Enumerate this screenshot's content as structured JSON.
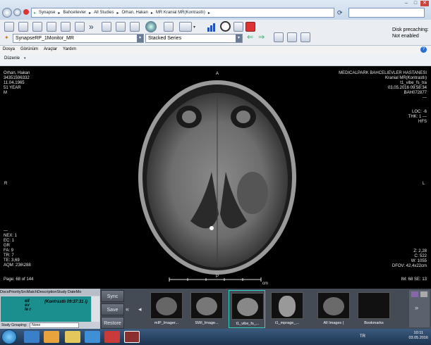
{
  "browser": {
    "breadcrumb": [
      "Synapse",
      "Bahcelievler",
      "All Studies",
      "Orhan, Hakan",
      "MR Kranial MR(Kontrastlı)"
    ]
  },
  "toolbar": {
    "layout_dropdown": "SynapseRP_1Monitor_MR",
    "series_dropdown": "Stacked Series",
    "disk_status_line1": "Disk precaching:",
    "disk_status_line2": "Not enabled"
  },
  "menu": [
    "Dosya",
    "Görünüm",
    "Araçlar",
    "Yardım"
  ],
  "subbar": {
    "label": "Düzenle"
  },
  "viewer": {
    "top_left": [
      "Orhan, Hakan",
      "34351596332",
      "11.04.1965",
      "51 YEAR",
      "M"
    ],
    "top_right": [
      "MEDICALPARK BAHCELIEVLER HASTANESI",
      "Kranial MR(Kontrastlı)",
      "t1_vibe_fs_tra",
      "03.05.2016 09:58:34",
      "BAH072877",
      "---"
    ],
    "orient_top": "A",
    "orient_left": "R",
    "orient_right": "L",
    "orient_bottom": "P",
    "loc_info": [
      "LOC: -6",
      "THK: 1 ---",
      "HFS"
    ],
    "bottom_left": [
      "---",
      "NEX: 1",
      "EC: 1",
      "GR",
      "FA: 9",
      "TR: 7",
      "TE: 3,69",
      "AQM: 236\\288"
    ],
    "bottom_right": [
      "Z: 2,28",
      "C: 522",
      "W: 1055",
      "DFOV: 42,4x22cm"
    ],
    "page_info": "Page: 68 of 144",
    "im_se_info": "IM: 68 SE: 13",
    "scale_unit": "cm"
  },
  "study_list": {
    "columns": [
      "Docs",
      "Priority",
      "Src",
      "Match",
      "Description",
      "Study Date",
      "Mo"
    ],
    "selected_row_text": "ell ev le r",
    "selected_row_desc": "(Kontrastlı 09:37:31 l)",
    "grouping_label": "Study Grouping:",
    "grouping_value": "None"
  },
  "side_buttons": [
    "Sync",
    "Save",
    "Restore"
  ],
  "thumbnails": [
    {
      "label": "mIP_Imager..."
    },
    {
      "label": "SWI_Image..."
    },
    {
      "label": "t1_vibe_fs_..."
    },
    {
      "label": "t1_mprage_..."
    },
    {
      "label": "All Images ("
    },
    {
      "label": "Bookmarks"
    }
  ],
  "taskbar": {
    "lang": "TR",
    "time": "10:11",
    "date": "03.05.2016"
  }
}
